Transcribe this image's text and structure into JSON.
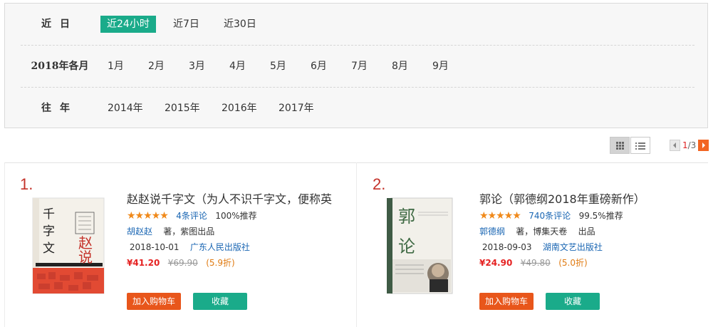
{
  "filter": {
    "row1": {
      "label": "近日",
      "options": [
        "近24小时",
        "近7日",
        "近30日"
      ],
      "active": 0
    },
    "row2": {
      "label": "2018年各月",
      "options": [
        "1月",
        "2月",
        "3月",
        "4月",
        "5月",
        "6月",
        "7月",
        "8月",
        "9月"
      ]
    },
    "row3": {
      "label": "往年",
      "options": [
        "2014年",
        "2015年",
        "2016年",
        "2017年"
      ]
    }
  },
  "view": {
    "grid_icon": "grid-icon",
    "list_icon": "list-icon",
    "selected": "grid"
  },
  "pager": {
    "current": "1",
    "total": "/3"
  },
  "items": [
    {
      "rank": "1.",
      "title": "赵赵说千字文（为人不识千字文，便称英",
      "stars": "★★★★★",
      "reviews": "4条评论",
      "recommend": "100%推荐",
      "author": "胡赵赵",
      "publisher_note": "著，紫图出品",
      "date": "2018-10-01",
      "press": "广东人民出版社",
      "price": "¥41.20",
      "old_price": "¥69.90",
      "discount": "(5.9折)",
      "cover_text": [
        "千字文",
        "赵赵说"
      ],
      "cart_label": "加入购物车",
      "fav_label": "收藏"
    },
    {
      "rank": "2.",
      "title": "郭论（郭德纲2018年重磅新作）",
      "stars": "★★★★★",
      "reviews": "740条评论",
      "recommend": "99.5%推荐",
      "author": "郭德纲",
      "publisher_note": "著，博集天卷",
      "publisher_note2": "出品",
      "date": "2018-09-03",
      "press": "湖南文艺出版社",
      "price": "¥24.90",
      "old_price": "¥49.80",
      "discount": "(5.0折)",
      "cover_text": [
        "郭论"
      ],
      "cart_label": "加入购物车",
      "fav_label": "收藏"
    }
  ],
  "colors": {
    "accent": "#1aab8a",
    "cart": "#e8561b",
    "price": "#e52222",
    "link": "#1a66b3"
  }
}
